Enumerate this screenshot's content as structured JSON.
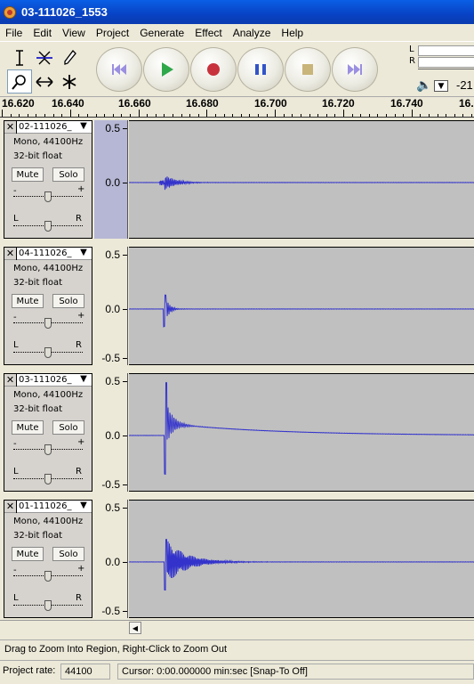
{
  "window": {
    "title": "03-111026_1553"
  },
  "menu": [
    "File",
    "Edit",
    "View",
    "Project",
    "Generate",
    "Effect",
    "Analyze",
    "Help"
  ],
  "tools": [
    "selection-tool",
    "envelope-tool",
    "draw-tool",
    "zoom-tool",
    "timeshift-tool",
    "multi-tool"
  ],
  "transport": [
    "skip-to-start",
    "play",
    "record",
    "pause",
    "stop",
    "skip-to-end"
  ],
  "meter": {
    "left": "L",
    "right": "R",
    "db_label": "-21"
  },
  "ruler": {
    "ticks": [
      "16.620",
      "16.640",
      "16.660",
      "16.680",
      "16.700",
      "16.720",
      "16.740",
      "16."
    ]
  },
  "tracks": [
    {
      "name": "02-111026_",
      "format": "Mono, 44100Hz",
      "bits": "32-bit float",
      "mute": "Mute",
      "solo": "Solo",
      "gain_min": "-",
      "gain_max": "+",
      "pan_l": "L",
      "pan_r": "R",
      "scale_top": "0.5",
      "scale_mid": "0.0",
      "scale_bot": "",
      "selected": true
    },
    {
      "name": "04-111026_",
      "format": "Mono, 44100Hz",
      "bits": "32-bit float",
      "mute": "Mute",
      "solo": "Solo",
      "gain_min": "-",
      "gain_max": "+",
      "pan_l": "L",
      "pan_r": "R",
      "scale_top": "0.5",
      "scale_mid": "0.0",
      "scale_bot": "-0.5",
      "selected": false
    },
    {
      "name": "03-111026_",
      "format": "Mono, 44100Hz",
      "bits": "32-bit float",
      "mute": "Mute",
      "solo": "Solo",
      "gain_min": "-",
      "gain_max": "+",
      "pan_l": "L",
      "pan_r": "R",
      "scale_top": "0.5",
      "scale_mid": "0.0",
      "scale_bot": "-0.5",
      "selected": false
    },
    {
      "name": "01-111026_",
      "format": "Mono, 44100Hz",
      "bits": "32-bit float",
      "mute": "Mute",
      "solo": "Solo",
      "gain_min": "-",
      "gain_max": "+",
      "pan_l": "L",
      "pan_r": "R",
      "scale_top": "0.5",
      "scale_mid": "0.0",
      "scale_bot": "-0.5",
      "selected": false
    }
  ],
  "status": {
    "message": "Drag to Zoom Into Region, Right-Click to Zoom Out",
    "rate_label": "Project rate:",
    "rate_value": "44100",
    "cursor": "Cursor: 0:00.000000 min:sec   [Snap-To Off]"
  },
  "colors": {
    "waveform": "#3333CC",
    "wave_bg": "#C0C0C0",
    "selected_ruler": "#B6B7D4"
  }
}
